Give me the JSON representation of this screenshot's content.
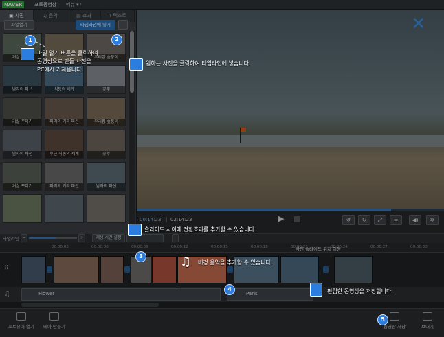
{
  "app": {
    "logo": "NAVER",
    "title": "포토동영상",
    "menu_label": "메뉴 ▾",
    "help_label": "?"
  },
  "tabs": [
    {
      "label": "▣ 사진",
      "active": true
    },
    {
      "label": "♫ 음악",
      "active": false
    },
    {
      "label": "▤ 효과",
      "active": false
    },
    {
      "label": "T 텍스트",
      "active": false
    }
  ],
  "left_panel": {
    "open_file_label": "파일열기",
    "add_timeline_label": "타임라인에 넣기"
  },
  "photos": [
    {
      "caption": "거실 꾸미기",
      "color": "#5d6a5c"
    },
    {
      "caption": "",
      "color": "#7a6d5a"
    },
    {
      "caption": "우리집 숲풍이",
      "color": "#6f6a66"
    },
    {
      "caption": "남자의 파션",
      "color": "#3e5560"
    },
    {
      "caption": "식동의 세계",
      "color": "#4f6f86"
    },
    {
      "caption": "꽃뿌",
      "color": "#8a8f95"
    },
    {
      "caption": "거실 꾸미기",
      "color": "#4e4e4a"
    },
    {
      "caption": "파리의 거리 파션",
      "color": "#6b5a4d"
    },
    {
      "caption": "우리집 숲풍이",
      "color": "#7d6c58"
    },
    {
      "caption": "남자의 파션",
      "color": "#59626a"
    },
    {
      "caption": "후근 식동의 세계",
      "color": "#5c4a40"
    },
    {
      "caption": "꽃뿌",
      "color": "#70665e"
    },
    {
      "caption": "거실 꾸미기",
      "color": "#596158"
    },
    {
      "caption": "파리의 거리 파션",
      "color": "#6a6a6a"
    },
    {
      "caption": "남자의 파션",
      "color": "#5e6d76"
    },
    {
      "caption": "",
      "color": "#6e7b62"
    },
    {
      "caption": "",
      "color": "#5d6870"
    },
    {
      "caption": "",
      "color": "#77706a"
    }
  ],
  "player": {
    "time_current": "00:14:23",
    "time_separator": "|",
    "time_total": "02:14:23",
    "progress": 0.83
  },
  "timeline_toolbar": {
    "label": "타임라인",
    "minus": "−",
    "plus": "+",
    "play_duration_label": "재생 시간 설정",
    "empty_btn_label": "",
    "extra_btn_label": ""
  },
  "ruler_ticks": [
    "00:00:03",
    "00:00:06",
    "00:00:09",
    "00:00:12",
    "00:00:15",
    "00:00:18",
    "00:00:21",
    "00:00:24",
    "00:00:27",
    "00:00:30"
  ],
  "ruler_title": "사진 슬라이드 위치 이동",
  "audio_clips": [
    {
      "name": "Flower"
    },
    {
      "name": "Paris"
    }
  ],
  "bottom_buttons": [
    {
      "label": "포토뷰어 열기"
    },
    {
      "label": "테마 만들기"
    },
    {
      "label": "동영상 저장"
    },
    {
      "label": "보내기"
    }
  ],
  "callouts": {
    "c1": "파일 열기 버튼을 클릭하여\n동영상으로 만들 사진을\nPC에서 가져옵니다.",
    "c2": "원하는 사진을 클릭하여 타임라인에 넣습니다.",
    "c3": "슬라이드 사이에 전환효과를 추가할 수 있습니다.",
    "c4": "배경 음악을 추가할 수 있습니다.",
    "c5": "편집한 동영상을 저장합니다.",
    "n1": "1",
    "n2": "2",
    "n3": "3",
    "n4": "4",
    "n5": "5"
  }
}
